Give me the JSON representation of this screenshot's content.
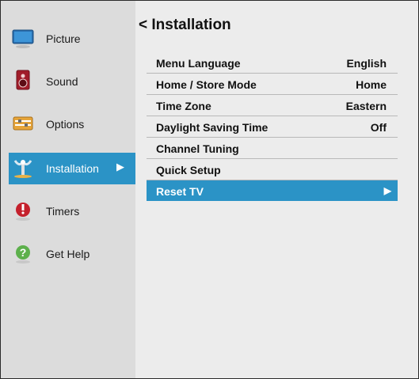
{
  "sidebar": {
    "items": [
      {
        "label": "Picture",
        "icon": "monitor-icon"
      },
      {
        "label": "Sound",
        "icon": "speaker-icon"
      },
      {
        "label": "Options",
        "icon": "options-icon"
      },
      {
        "label": "Installation",
        "icon": "satellite-icon",
        "active": true,
        "arrow": "▶"
      },
      {
        "label": "Timers",
        "icon": "timer-icon"
      },
      {
        "label": "Get Help",
        "icon": "help-icon"
      }
    ]
  },
  "main": {
    "title": "< Installation",
    "rows": [
      {
        "label": "Menu Language",
        "value": "English"
      },
      {
        "label": "Home / Store Mode",
        "value": "Home"
      },
      {
        "label": "Time Zone",
        "value": "Eastern"
      },
      {
        "label": "Daylight Saving Time",
        "value": "Off"
      },
      {
        "label": "Channel Tuning",
        "value": ""
      },
      {
        "label": "Quick Setup",
        "value": ""
      },
      {
        "label": "Reset TV",
        "value": "",
        "selected": true,
        "arrow": "▶"
      }
    ]
  },
  "colors": {
    "accent": "#2b93c6",
    "sidebar_bg": "#dcdcdc",
    "main_bg": "#ececec"
  }
}
